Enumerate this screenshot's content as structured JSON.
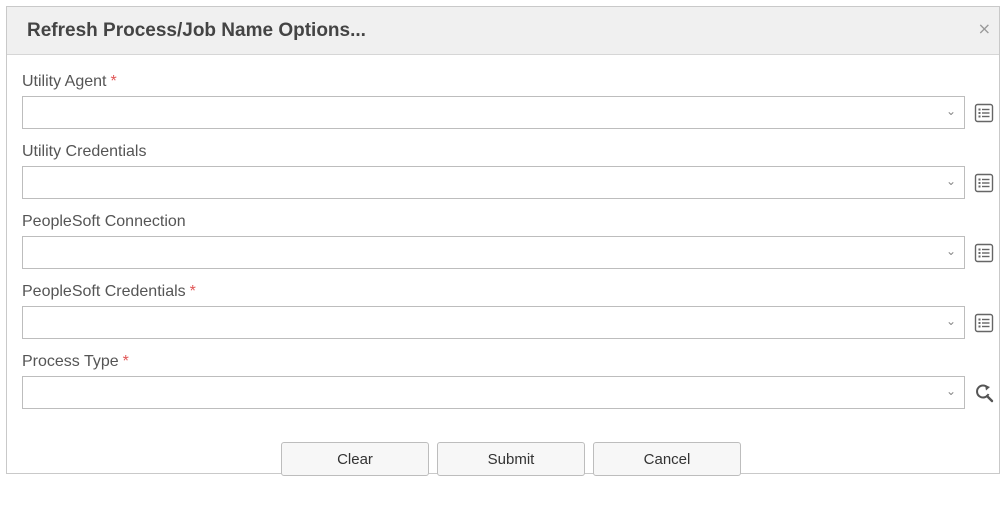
{
  "dialog": {
    "title": "Refresh Process/Job Name Options...",
    "close_glyph": "×"
  },
  "fields": [
    {
      "label": "Utility Agent",
      "required": true,
      "value": "",
      "side_icon": "list-icon"
    },
    {
      "label": "Utility Credentials",
      "required": false,
      "value": "",
      "side_icon": "list-icon"
    },
    {
      "label": "PeopleSoft Connection",
      "required": false,
      "value": "",
      "side_icon": "list-icon"
    },
    {
      "label": "PeopleSoft Credentials",
      "required": true,
      "value": "",
      "side_icon": "list-icon"
    },
    {
      "label": "Process Type",
      "required": true,
      "value": "",
      "side_icon": "refresh-search-icon"
    }
  ],
  "required_marker": "*",
  "buttons": {
    "clear": "Clear",
    "submit": "Submit",
    "cancel": "Cancel"
  },
  "colors": {
    "required": "#e05555",
    "header_bg": "#f0f0f0"
  }
}
